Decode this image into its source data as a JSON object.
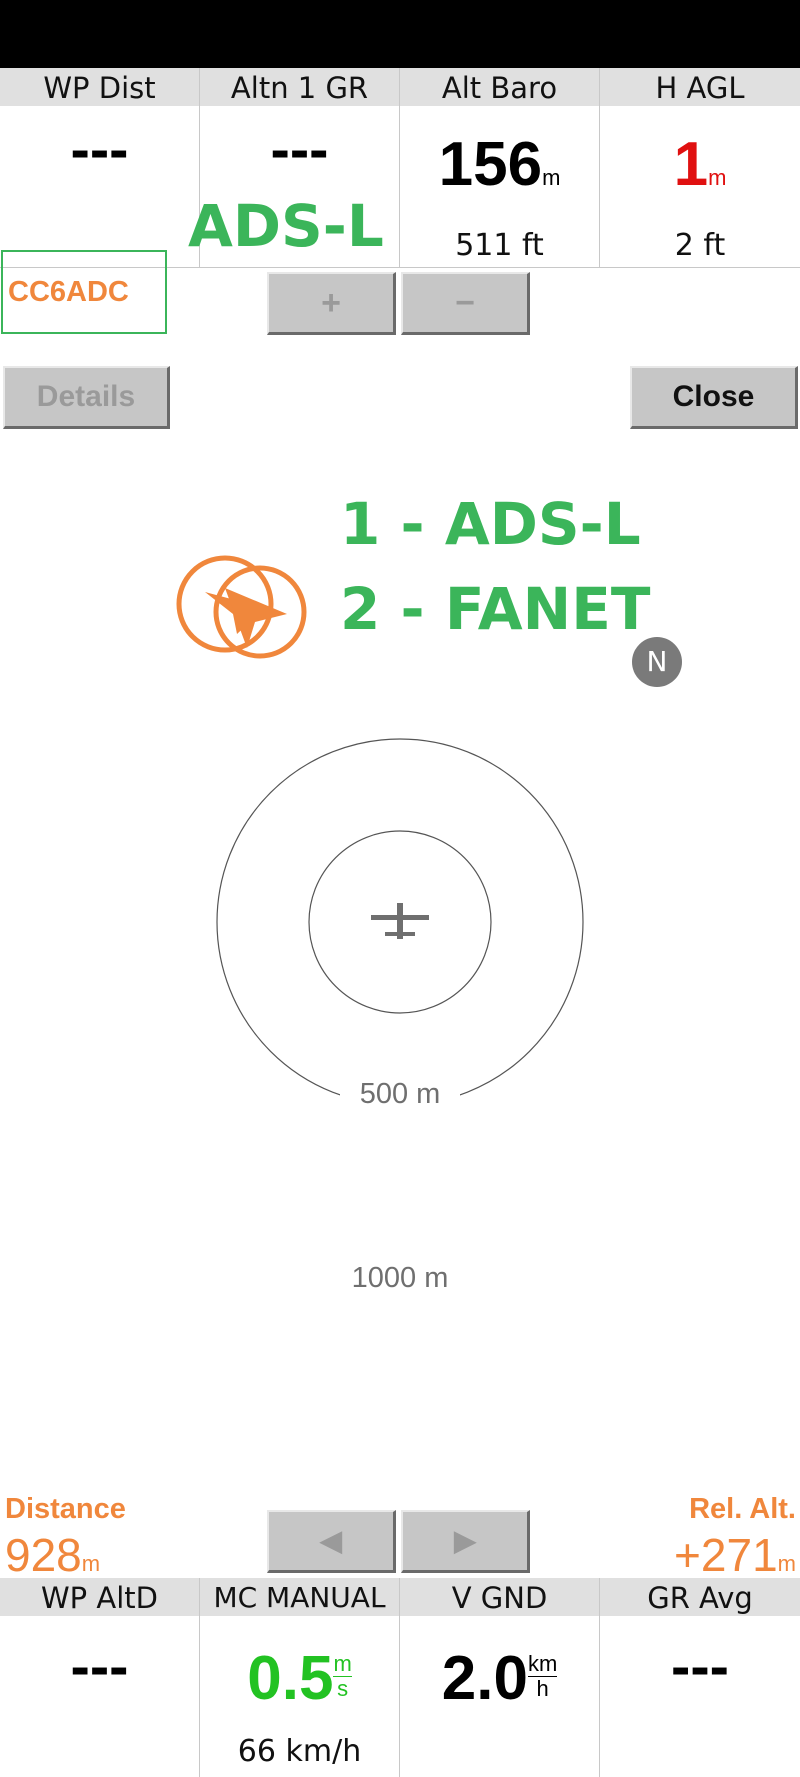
{
  "top_infoboxes": [
    {
      "title": "WP Dist",
      "value": "---",
      "unit": "",
      "sub": ""
    },
    {
      "title": "Altn 1 GR",
      "value": "---",
      "unit": "",
      "sub": ""
    },
    {
      "title": "Alt Baro",
      "value": "156",
      "unit": "m",
      "sub": "511 ft"
    },
    {
      "title": "H AGL",
      "value": "1",
      "unit": "m",
      "sub": "2 ft"
    }
  ],
  "traffic": {
    "id": "CC6ADC",
    "type_label": "ADS-L",
    "sources": [
      "1 - ADS-L",
      "2 - FANET"
    ]
  },
  "buttons": {
    "plus": "+",
    "minus": "−",
    "details": "Details",
    "close": "Close",
    "prev": "◀",
    "next": "▶"
  },
  "radar": {
    "north": "N",
    "ring_inner_label": "500 m",
    "ring_outer_label": "1000 m"
  },
  "distance": {
    "label": "Distance",
    "value": "928",
    "unit": "m"
  },
  "rel_alt": {
    "label": "Rel. Alt.",
    "value": "+271",
    "unit": "m"
  },
  "bottom_infoboxes": [
    {
      "title": "WP AltD",
      "value": "---",
      "sub": ""
    },
    {
      "title": "MC MANUAL",
      "value": "0.5",
      "unit_top": "m",
      "unit_bottom": "s",
      "sub": "66 km/h"
    },
    {
      "title": "V GND",
      "value": "2.0",
      "unit_top": "km",
      "unit_bottom": "h",
      "sub": ""
    },
    {
      "title": "GR Avg",
      "value": "---",
      "sub": ""
    }
  ],
  "colors": {
    "accent_green": "#3bb55a",
    "accent_orange": "#f0873c",
    "alert_red": "#e01010"
  }
}
